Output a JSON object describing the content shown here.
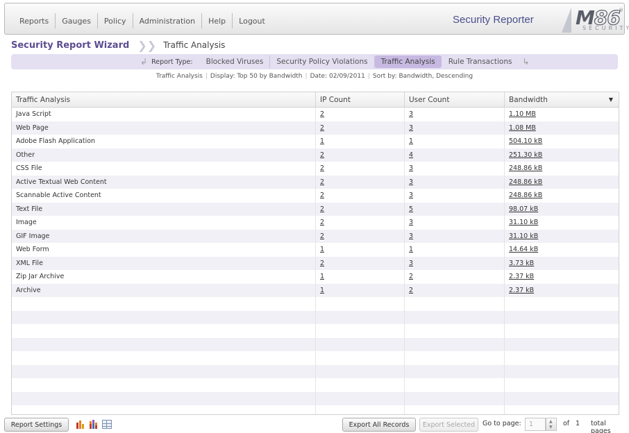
{
  "nav": {
    "items": [
      "Reports",
      "Gauges",
      "Policy",
      "Administration",
      "Help",
      "Logout"
    ],
    "product_title": "Security Reporter"
  },
  "logo": {
    "mark": "M86",
    "sub": "SECURITY",
    "registered": "®"
  },
  "breadcrumb": {
    "wizard": "Security Report Wizard",
    "page": "Traffic Analysis"
  },
  "report_type": {
    "label": "Report Type:",
    "tabs": [
      {
        "label": "Blocked Viruses",
        "active": false
      },
      {
        "label": "Security Policy Violations",
        "active": false
      },
      {
        "label": "Traffic Analysis",
        "active": true
      },
      {
        "label": "Rule Transactions",
        "active": false
      }
    ]
  },
  "info": {
    "type": "Traffic Analysis",
    "display": "Display: Top 50 by Bandwidth",
    "date": "Date: 02/09/2011",
    "sort": "Sort by: Bandwidth, Descending"
  },
  "table": {
    "headers": [
      "Traffic Analysis",
      "IP Count",
      "User Count",
      "Bandwidth"
    ],
    "sort_icon": "▼",
    "rows": [
      {
        "name": "Java Script",
        "ip": "2",
        "users": "3",
        "bandwidth": "1.10 MB"
      },
      {
        "name": "Web Page",
        "ip": "2",
        "users": "3",
        "bandwidth": "1.08 MB"
      },
      {
        "name": "Adobe Flash Application",
        "ip": "1",
        "users": "1",
        "bandwidth": "504.10 kB"
      },
      {
        "name": "Other",
        "ip": "2",
        "users": "4",
        "bandwidth": "251.30 kB"
      },
      {
        "name": "CSS File",
        "ip": "2",
        "users": "3",
        "bandwidth": "248.86 kB"
      },
      {
        "name": "Active Textual Web Content",
        "ip": "2",
        "users": "3",
        "bandwidth": "248.86 kB"
      },
      {
        "name": "Scannable Active Content",
        "ip": "2",
        "users": "3",
        "bandwidth": "248.86 kB"
      },
      {
        "name": "Text File",
        "ip": "2",
        "users": "5",
        "bandwidth": "98.07 kB"
      },
      {
        "name": "Image",
        "ip": "2",
        "users": "3",
        "bandwidth": "31.10 kB"
      },
      {
        "name": "GIF Image",
        "ip": "2",
        "users": "3",
        "bandwidth": "31.10 kB"
      },
      {
        "name": "Web Form",
        "ip": "1",
        "users": "1",
        "bandwidth": "14.64 kB"
      },
      {
        "name": "XML File",
        "ip": "2",
        "users": "3",
        "bandwidth": "3.73 kB"
      },
      {
        "name": "Zip Jar Archive",
        "ip": "1",
        "users": "2",
        "bandwidth": "2.37 kB"
      },
      {
        "name": "Archive",
        "ip": "1",
        "users": "2",
        "bandwidth": "2.37 kB"
      }
    ],
    "empty_rows": 9
  },
  "footer": {
    "report_settings": "Report Settings",
    "export_all": "Export All Records",
    "export_selected": "Export Selected",
    "goto_label": "Go to page:",
    "page_value": "1",
    "of": "of",
    "total": "1",
    "total_label": "total pages"
  },
  "colors": {
    "accent": "#5c4d92",
    "band": "#e4dff1",
    "active_tab": "#c7b9e2",
    "alt_row": "#f1f0f6"
  },
  "icons": [
    "bar-chart-icon",
    "stacked-bar-chart-icon",
    "table-grid-icon",
    "sort-descending-icon",
    "spinner-icon"
  ]
}
